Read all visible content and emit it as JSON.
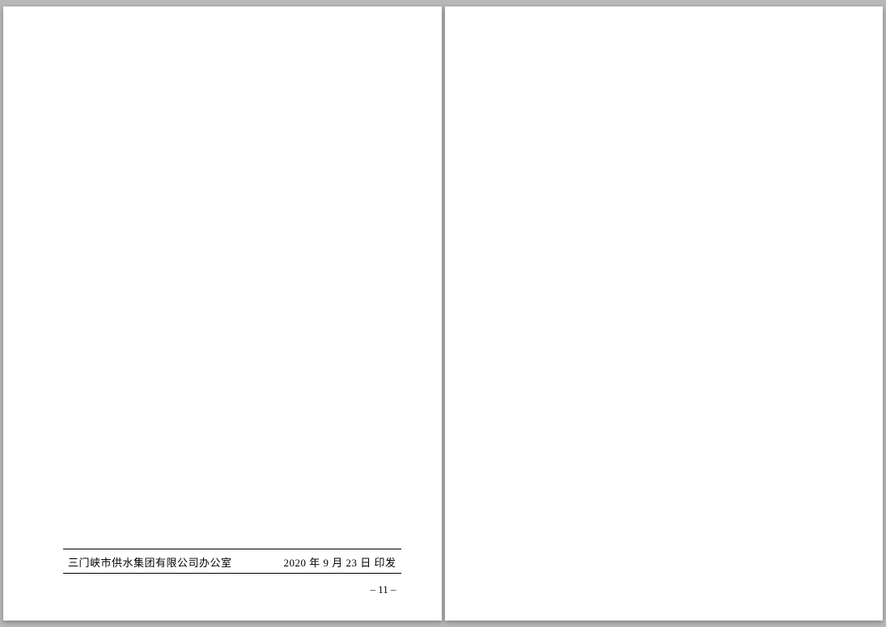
{
  "leftPage": {
    "footer": {
      "issuer": "三门峡市供水集团有限公司办公室",
      "date": "2020 年 9 月 23 日 印发"
    },
    "pageNumber": "– 11 –"
  }
}
